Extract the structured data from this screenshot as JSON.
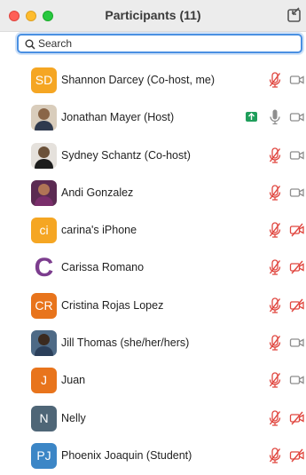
{
  "window": {
    "title": "Participants (11)"
  },
  "search": {
    "placeholder": "Search"
  },
  "participants": [
    {
      "name": "Shannon Darcey (Co-host, me)",
      "avatar_initials": "SD",
      "avatar_color": "#f5a623",
      "mic": "muted",
      "video": "off"
    },
    {
      "name": "Jonathan Mayer (Host)",
      "avatar_initials": "",
      "avatar_color": "",
      "mic": "on",
      "video": "off",
      "screen_sharing": true
    },
    {
      "name": "Sydney Schantz (Co-host)",
      "avatar_initials": "",
      "avatar_color": "",
      "mic": "muted",
      "video": "off"
    },
    {
      "name": "Andi Gonzalez",
      "avatar_initials": "",
      "avatar_color": "",
      "mic": "muted",
      "video": "off"
    },
    {
      "name": "carina's iPhone",
      "avatar_initials": "ci",
      "avatar_color": "#f5a623",
      "mic": "muted",
      "video": "blocked"
    },
    {
      "name": "Carissa Romano",
      "avatar_initials": "C",
      "avatar_color": "#ffffff",
      "mic": "muted",
      "video": "blocked"
    },
    {
      "name": "Cristina Rojas Lopez",
      "avatar_initials": "CR",
      "avatar_color": "#e8741c",
      "mic": "muted",
      "video": "blocked"
    },
    {
      "name": "Jill Thomas (she/her/hers)",
      "avatar_initials": "",
      "avatar_color": "",
      "mic": "muted",
      "video": "off"
    },
    {
      "name": "Juan",
      "avatar_initials": "J",
      "avatar_color": "#e8741c",
      "mic": "muted",
      "video": "off"
    },
    {
      "name": "Nelly",
      "avatar_initials": "N",
      "avatar_color": "#4f6677",
      "mic": "muted",
      "video": "blocked"
    },
    {
      "name": "Phoenix Joaquin (Student)",
      "avatar_initials": "PJ",
      "avatar_color": "#3c86c6",
      "mic": "muted",
      "video": "blocked"
    }
  ],
  "colors": {
    "muted_red": "#e0463f",
    "icon_gray": "#8e8e8e",
    "search_focus": "#4a90e2",
    "share_green": "#1f9e5b"
  },
  "icons": {
    "popout": "popout-icon",
    "search": "search-icon",
    "mic_muted": "mic-muted-icon",
    "mic": "mic-icon",
    "camera_off": "camera-icon",
    "camera_blocked": "camera-blocked-icon",
    "share": "screen-share-icon"
  }
}
